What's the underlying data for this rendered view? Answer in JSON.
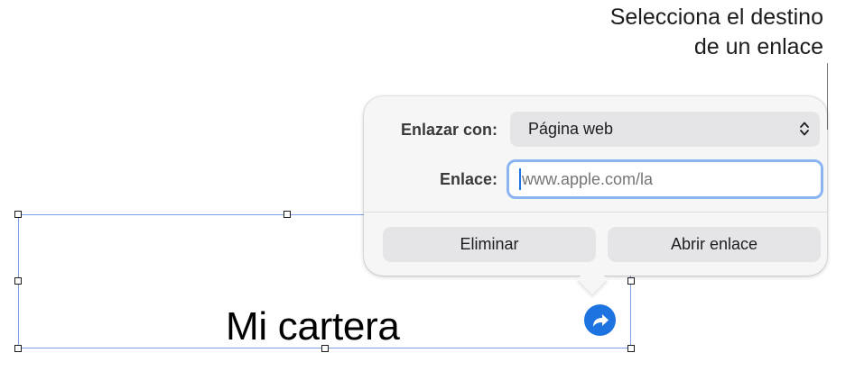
{
  "callout": {
    "line1": "Selecciona el destino",
    "line2": "de un enlace"
  },
  "canvas": {
    "text": "Mi cartera",
    "link_badge_icon": "arrow-link-icon"
  },
  "popover": {
    "link_to_label": "Enlazar con:",
    "link_to_value": "Página web",
    "link_label": "Enlace:",
    "link_placeholder": "www.apple.com/la",
    "remove_button": "Eliminar",
    "open_button": "Abrir enlace"
  },
  "colors": {
    "accent": "#1d74e0",
    "focus_ring": "#8bb4f1",
    "selection_border": "#7fa1e6"
  }
}
